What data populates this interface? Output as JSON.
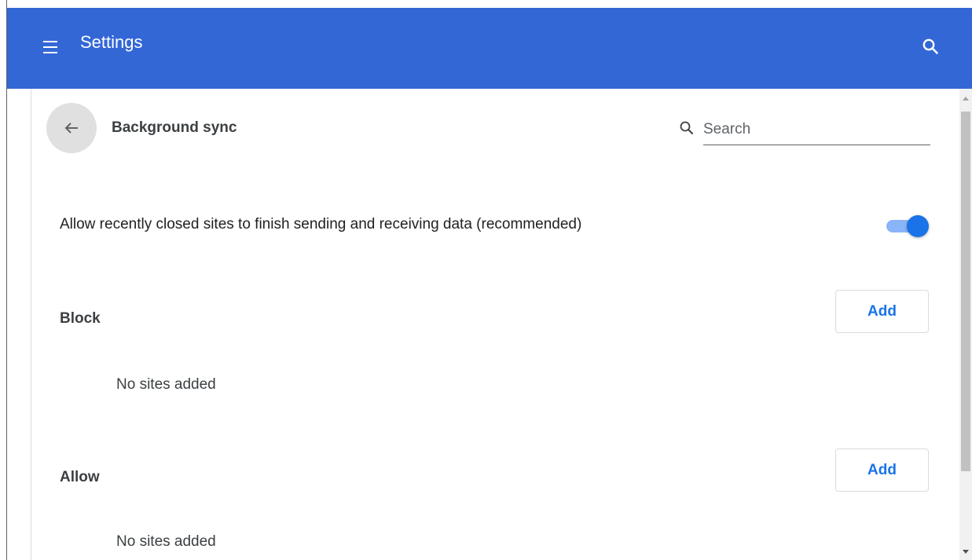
{
  "header": {
    "title": "Settings",
    "menu_icon": "hamburger-menu-icon",
    "search_icon": "search-icon",
    "background_color": "#3367d6"
  },
  "page": {
    "title": "Background sync",
    "back_icon": "arrow-back-icon",
    "search": {
      "placeholder": "Search",
      "value": ""
    }
  },
  "setting": {
    "label": "Allow recently closed sites to finish sending and receiving data (recommended)",
    "enabled": true,
    "toggle_color": "#1a73e8"
  },
  "sections": {
    "block": {
      "heading": "Block",
      "add_label": "Add",
      "empty_text": "No sites added"
    },
    "allow": {
      "heading": "Allow",
      "add_label": "Add",
      "empty_text": "No sites added"
    }
  },
  "colors": {
    "accent": "#1a73e8",
    "text_primary": "#202124",
    "text_secondary": "#3c4043"
  }
}
